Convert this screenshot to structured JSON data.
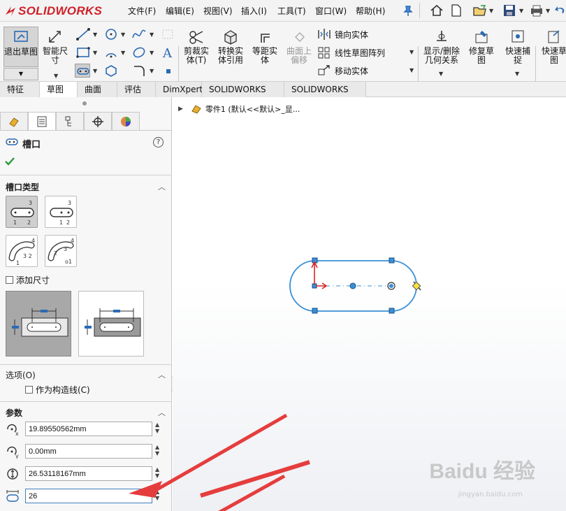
{
  "app": {
    "logo": "SOLIDWORKS"
  },
  "menu": [
    "文件(F)",
    "编辑(E)",
    "视图(V)",
    "插入(I)",
    "工具(T)",
    "窗口(W)",
    "帮助(H)"
  ],
  "ribbon": {
    "exit_sketch": "退出草图",
    "smart_dim": "智能尺寸",
    "trim": "剪裁实体(T)",
    "convert": "转换实体引用",
    "offset": "等距实体",
    "offset_surface": "曲面上偏移",
    "mirror": "镜向实体",
    "linear_pattern": "线性草图阵列",
    "move": "移动实体",
    "display_relations": "显示/删除几何关系",
    "repair": "修复草图",
    "quick_snap": "快速捕捉",
    "quick_view": "快速草图"
  },
  "tabs": [
    "特征",
    "草图",
    "曲面",
    "评估",
    "DimXpert",
    "SOLIDWORKS 插件",
    "SOLIDWORKS MBD"
  ],
  "active_tab": "草图",
  "panel": {
    "title": "槽口",
    "slot_type_title": "槽口类型",
    "add_dimensions": "添加尺寸",
    "options_title": "选项(O)",
    "construction": "作为构造线(C)",
    "params_title": "参数",
    "params": {
      "x": "19.89550562mm",
      "y": "0.00mm",
      "length": "26.53118167mm",
      "width": "26"
    }
  },
  "tree": {
    "item": "零件1  (默认<<默认>_显..."
  },
  "watermark": {
    "main": "Baidu 经验",
    "sub": "jingyan.baidu.com"
  },
  "colors": {
    "accent": "#1a6fc2",
    "sketch": "#3b8fd6",
    "logo": "#d0202a"
  }
}
